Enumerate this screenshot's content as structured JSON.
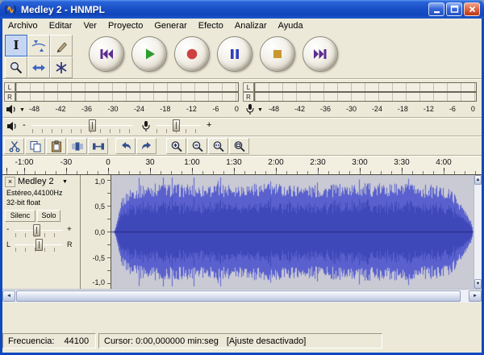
{
  "window": {
    "title": "Medley 2 - HNMPL"
  },
  "menu": {
    "items": [
      "Archivo",
      "Editar",
      "Ver",
      "Proyecto",
      "Generar",
      "Efecto",
      "Analizar",
      "Ayuda"
    ]
  },
  "meters": {
    "left_channel_label": "L",
    "right_channel_label": "R",
    "db_scale": [
      "-48",
      "-42",
      "-36",
      "-30",
      "-24",
      "-18",
      "-12",
      "-6",
      "0"
    ]
  },
  "mixer": {
    "minus_label": "-",
    "plus_label": "+"
  },
  "timeline": {
    "labels": [
      "-1:00",
      "-30",
      "0",
      "30",
      "1:00",
      "1:30",
      "2:00",
      "2:30",
      "3:00",
      "3:30",
      "4:00"
    ]
  },
  "track": {
    "close_label": "×",
    "name": "Medley 2",
    "dropdown_glyph": "▼",
    "format_line1": "Estéreo,44100Hz",
    "format_line2": "32-bit float",
    "mute_label": "Silenc",
    "solo_label": "Solo",
    "gain_minus": "-",
    "gain_plus": "+",
    "pan_left": "L",
    "pan_right": "R",
    "amplitude_ruler": [
      "1,0",
      "0,5",
      "0,0",
      "-0,5",
      "-1,0"
    ]
  },
  "status": {
    "rate_label": "Frecuencia:",
    "rate_value": "44100",
    "cursor_text": "Cursor: 0:00,000000 min:seg",
    "snap_text": "[Ajuste desactivado]"
  },
  "waveform": {
    "background": "#c9cad4",
    "peak_color": "#5a61ce",
    "rms_color": "#3f48b8",
    "center_line_color": "#23267e",
    "envelope": [
      [
        0,
        0.04
      ],
      [
        0.006,
        0.18
      ],
      [
        0.02,
        0.62
      ],
      [
        0.045,
        0.82
      ],
      [
        0.1,
        0.9
      ],
      [
        0.25,
        0.87
      ],
      [
        0.4,
        0.91
      ],
      [
        0.55,
        0.86
      ],
      [
        0.7,
        0.9
      ],
      [
        0.82,
        0.88
      ],
      [
        0.9,
        0.86
      ],
      [
        0.94,
        0.78
      ],
      [
        0.97,
        0.5
      ],
      [
        0.99,
        0.25
      ],
      [
        1,
        0.06
      ]
    ]
  },
  "colors": {
    "titlebar_blue": "#1a50c8",
    "client_bg": "#ece9d8",
    "play_green": "#2d9c2d",
    "record_red": "#cf4040",
    "pause_blue": "#2f3fbf",
    "stop_amber": "#c9972f",
    "skip_purple": "#5c2d91",
    "active_tool_accent": "#316ac5"
  },
  "icons": {
    "audacity-logo-icon": "headphones-with-orange-wave",
    "minimize-icon": "underscore-bar",
    "maximize-icon": "square-outline",
    "close-icon": "x-cross",
    "selection-tool-icon": "i-beam",
    "envelope-tool-icon": "envelope-control-points",
    "draw-tool-icon": "pencil",
    "zoom-tool-icon": "magnifier",
    "timeshift-tool-icon": "double-headed-arrow",
    "multitool-icon": "asterisk-star",
    "skip-start-icon": "bar-with-double-triangle-left",
    "play-icon": "triangle-right",
    "record-icon": "filled-circle",
    "pause-icon": "double-vertical-bars",
    "stop-icon": "filled-square",
    "skip-end-icon": "double-triangle-right-with-bar",
    "speaker-icon": "loudspeaker",
    "microphone-icon": "microphone",
    "dropdown-arrow-icon": "small-down-triangle",
    "cut-icon": "scissors",
    "copy-icon": "two-pages",
    "paste-icon": "clipboard",
    "trim-icon": "trim-outside-selection",
    "silence-icon": "flatten-selection",
    "undo-icon": "curved-arrow-left",
    "redo-icon": "curved-arrow-right",
    "zoom-in-icon": "magnifier-plus",
    "zoom-out-icon": "magnifier-minus",
    "fit-selection-icon": "magnifier-selection",
    "fit-project-icon": "magnifier-project",
    "scroll-up-icon": "triangle-up",
    "scroll-down-icon": "triangle-down",
    "scroll-left-icon": "triangle-left",
    "scroll-right-icon": "triangle-right"
  }
}
